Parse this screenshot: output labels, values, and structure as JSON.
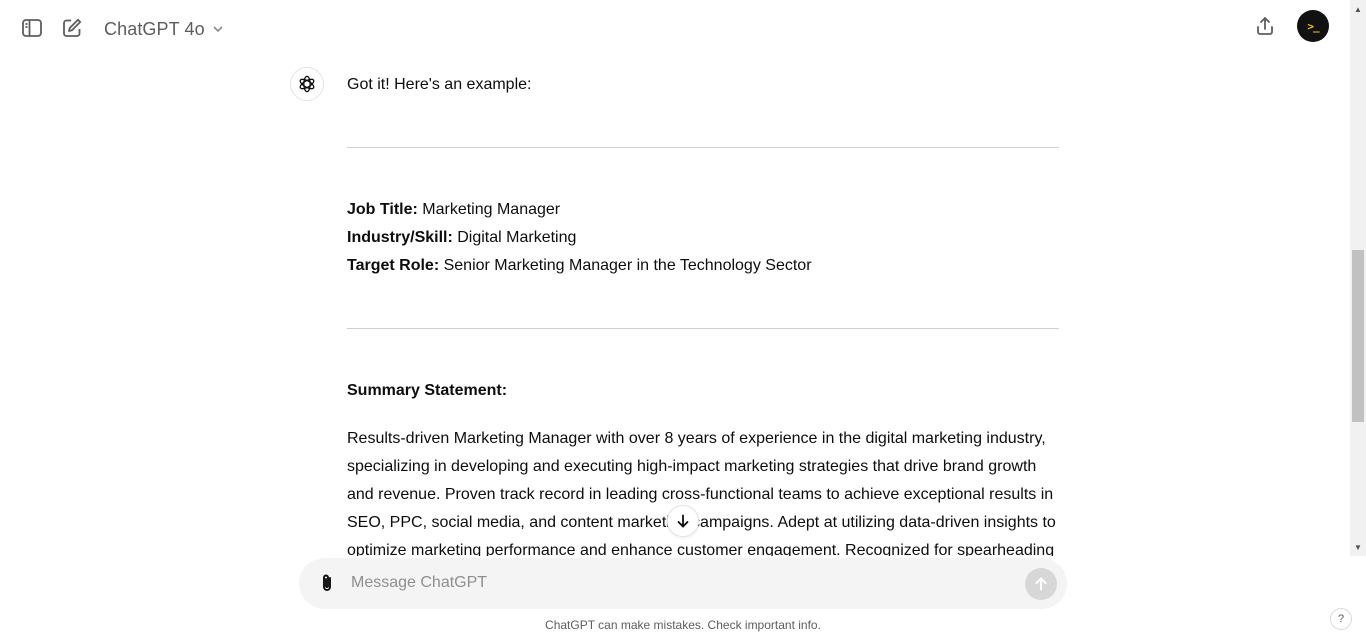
{
  "header": {
    "model_name": "ChatGPT 4o",
    "avatar_text": ">_"
  },
  "conversation": {
    "intro": "Got it! Here's an example:",
    "fields": [
      {
        "label": "Job Title:",
        "value": " Marketing Manager"
      },
      {
        "label": "Industry/Skill:",
        "value": " Digital Marketing"
      },
      {
        "label": "Target Role:",
        "value": " Senior Marketing Manager in the Technology Sector"
      }
    ],
    "summary_heading": "Summary Statement:",
    "summary_body": "Results-driven Marketing Manager with over 8 years of experience in the digital marketing industry, specializing in developing and executing high-impact marketing strategies that drive brand growth and revenue. Proven track record in leading cross-functional teams to achieve exceptional results in SEO, PPC, social media, and content marketing campaigns. Adept at utilizing data-driven insights to optimize marketing performance and enhance customer engagement. Recognized for spearheading"
  },
  "composer": {
    "placeholder": "Message ChatGPT"
  },
  "footer": {
    "disclaimer": "ChatGPT can make mistakes. Check important info.",
    "help_label": "?"
  },
  "icons": {
    "sidebar_toggle": "sidebar-toggle-icon",
    "new_chat": "new-chat-icon",
    "model_chevron": "chevron-down-icon",
    "share": "share-icon",
    "assistant": "openai-logo-icon",
    "scroll_down": "arrow-down-icon",
    "attach": "paperclip-icon",
    "send": "arrow-up-icon"
  }
}
